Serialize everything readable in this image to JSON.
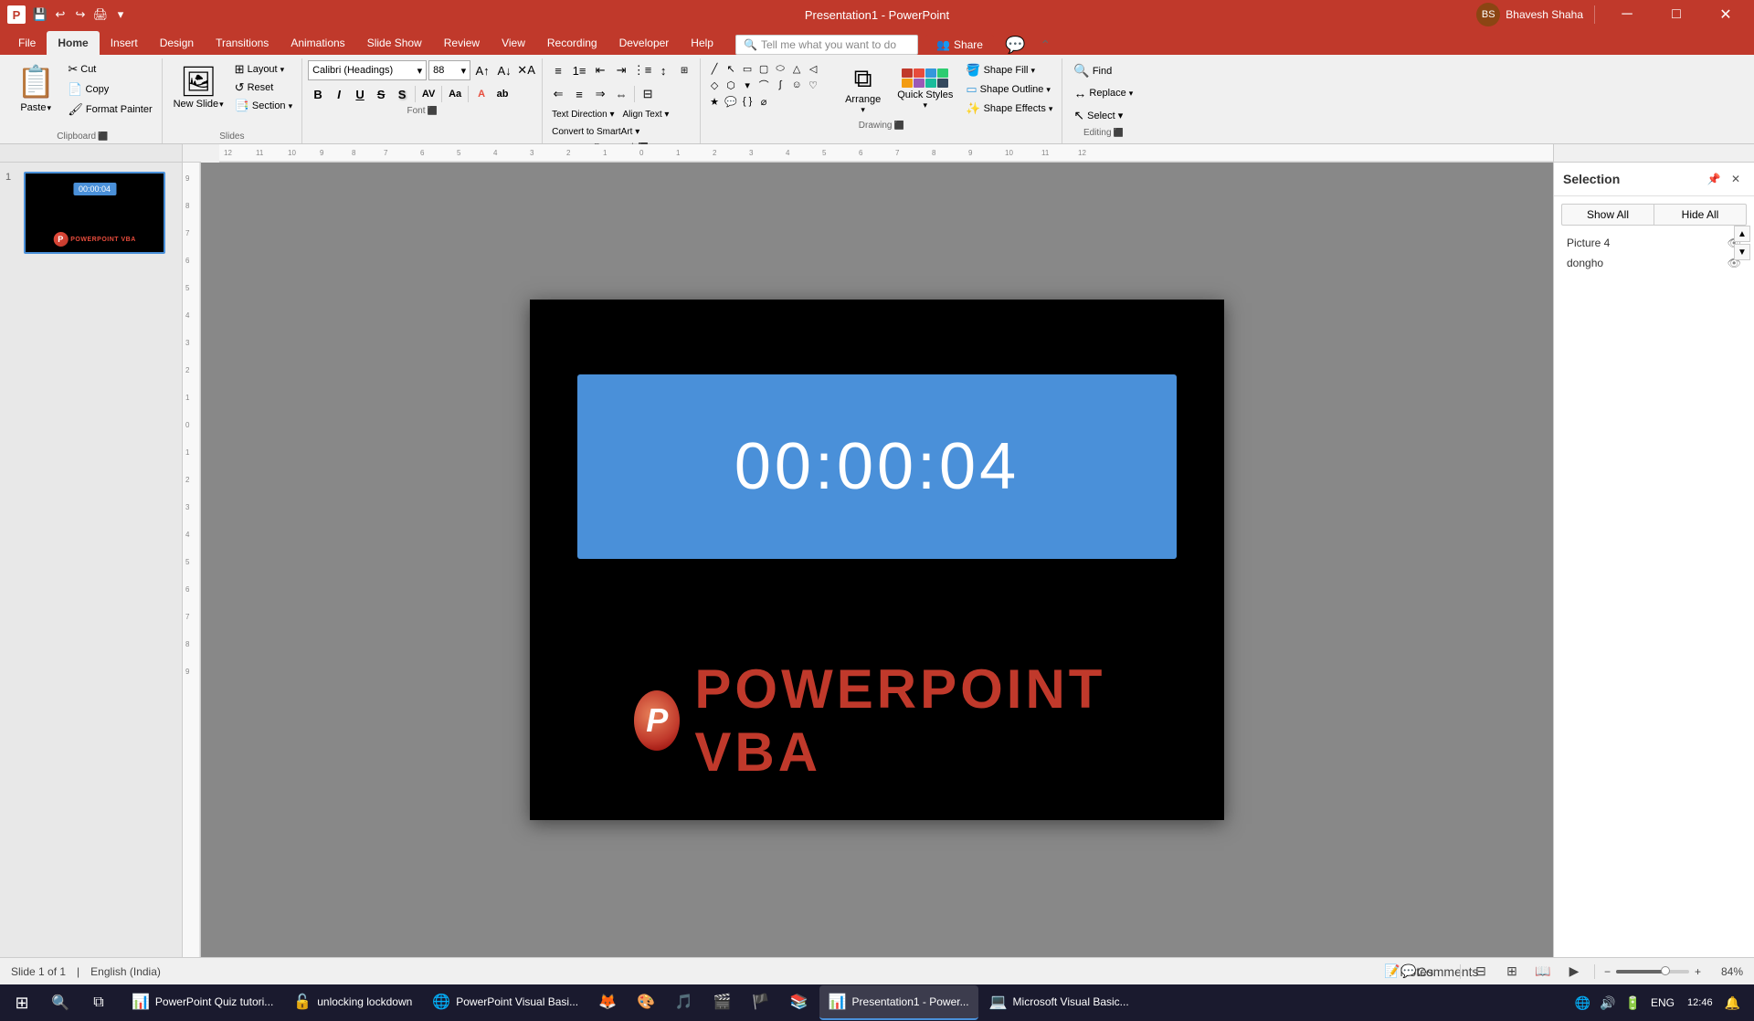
{
  "titleBar": {
    "appName": "Presentation1 - PowerPoint",
    "userName": "Bhavesh Shaha",
    "quickAccess": [
      "💾",
      "↩",
      "↪",
      "🖨",
      "📋",
      "👁",
      "▾"
    ]
  },
  "ribbonTabs": {
    "tabs": [
      "File",
      "Home",
      "Insert",
      "Design",
      "Transitions",
      "Animations",
      "Slide Show",
      "Review",
      "View",
      "Recording",
      "Developer",
      "Help"
    ],
    "activeTab": "Home",
    "tellMe": "Tell me what you want to do"
  },
  "ribbon": {
    "clipboard": {
      "label": "Clipboard",
      "paste": "Paste",
      "cut": "Cut",
      "copy": "Copy",
      "formatPainter": "Format Painter"
    },
    "slides": {
      "label": "Slides",
      "newSlide": "New Slide",
      "layout": "Layout",
      "reset": "Reset",
      "section": "Section"
    },
    "font": {
      "label": "Font",
      "fontName": "Calibri (Headings)",
      "fontSize": "88",
      "bold": "B",
      "italic": "I",
      "underline": "U",
      "strikethrough": "S",
      "shadow": "S",
      "charSpacing": "AV",
      "changeCase": "Aa",
      "fontColor": "A"
    },
    "paragraph": {
      "label": "Paragraph",
      "textDirection": "Text Direction",
      "alignText": "Align Text",
      "convertToSmartArt": "Convert to SmartArt"
    },
    "drawing": {
      "label": "Drawing",
      "arrange": "Arrange",
      "quickStyles": "Quick Styles",
      "shapeFill": "Shape Fill",
      "shapeOutline": "Shape Outline",
      "shapeEffects": "Shape Effects"
    },
    "editing": {
      "label": "Editing",
      "find": "Find",
      "replace": "Replace",
      "select": "Select ▾"
    }
  },
  "slidePanel": {
    "slides": [
      {
        "number": "1",
        "timer": "00:00:04",
        "logoText": "POWERPOINT VBA"
      }
    ]
  },
  "canvas": {
    "timerText": "00:00:04",
    "logoText": "POWERPOINT VBA",
    "logoLetter": "P"
  },
  "selectionPanel": {
    "title": "Selection",
    "showAll": "Show All",
    "hideAll": "Hide All",
    "items": [
      {
        "name": "Picture 4",
        "visible": true
      },
      {
        "name": "dongho",
        "visible": true
      }
    ],
    "scrollUp": "▲",
    "scrollDown": "▼"
  },
  "statusBar": {
    "slideInfo": "Slide 1 of 1",
    "language": "English (India)",
    "notes": "Notes",
    "comments": "Comments",
    "zoomLevel": "84%",
    "zoom": 84
  },
  "taskbar": {
    "apps": [
      {
        "icon": "📊",
        "label": "PowerPoint Quiz tutori...",
        "active": false
      },
      {
        "icon": "🔓",
        "label": "unlocking lockdown",
        "active": false
      },
      {
        "icon": "🌐",
        "label": "PowerPoint Visual Basi...",
        "active": false
      },
      {
        "icon": "🔥",
        "label": "",
        "active": false
      },
      {
        "icon": "🎨",
        "label": "",
        "active": false
      },
      {
        "icon": "⭕",
        "label": "",
        "active": false
      },
      {
        "icon": "📊",
        "label": "",
        "active": false
      },
      {
        "icon": "🏴",
        "label": "",
        "active": false
      },
      {
        "icon": "📚",
        "label": "",
        "active": false
      },
      {
        "icon": "📊",
        "label": "Presentation1 - Power...",
        "active": true
      },
      {
        "icon": "💻",
        "label": "Microsoft Visual Basic...",
        "active": false
      }
    ],
    "tray": {
      "time": "12:46",
      "date": "",
      "lang": "ENG"
    }
  }
}
